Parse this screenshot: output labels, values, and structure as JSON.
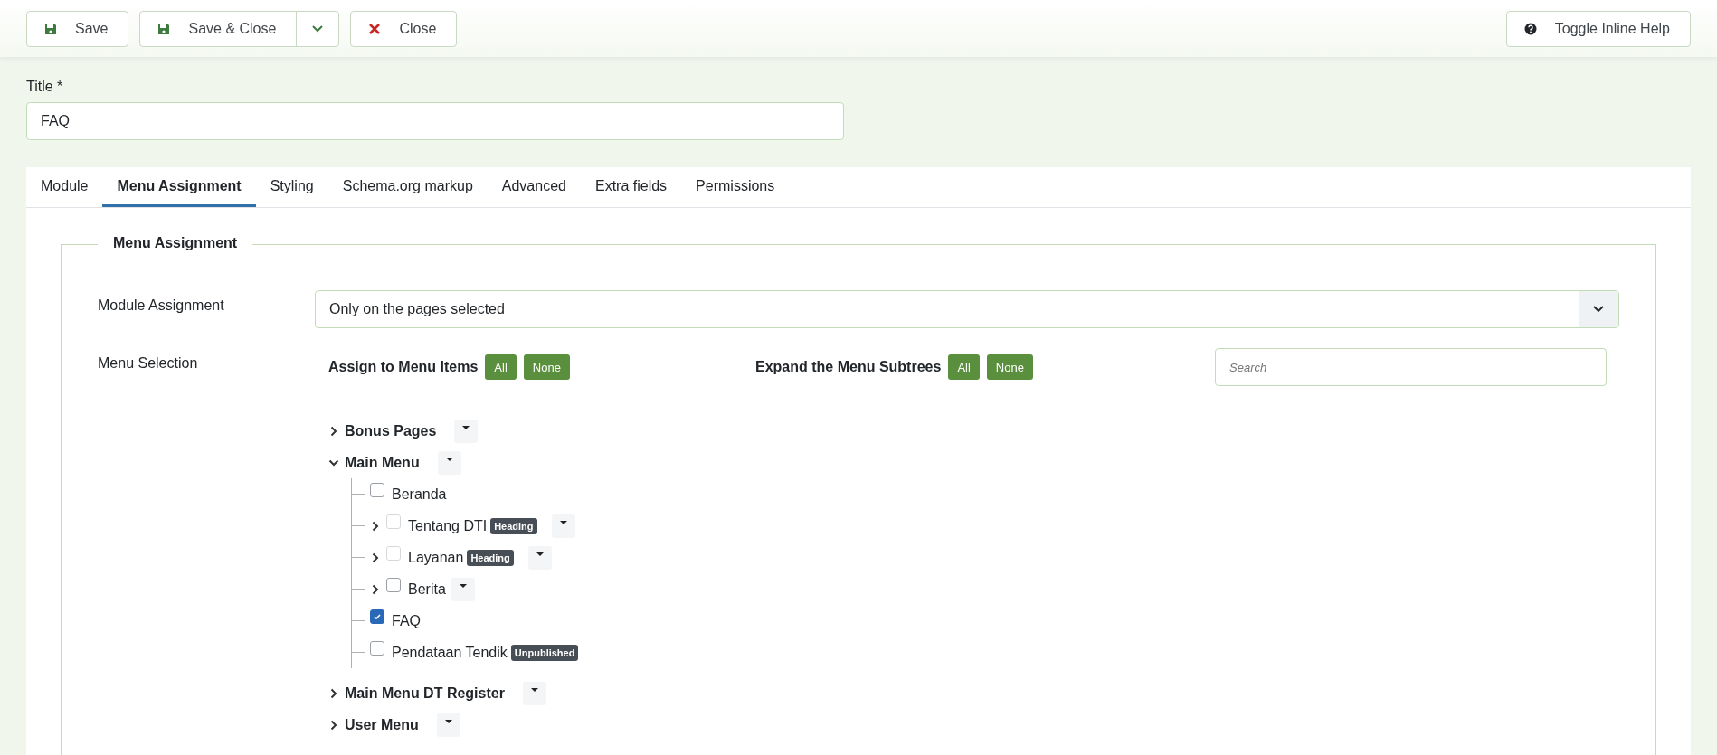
{
  "toolbar": {
    "buttons": [
      {
        "label": "Save",
        "kind": "save"
      },
      {
        "label": "Save & Close",
        "kind": "save-split"
      },
      {
        "label": "Close",
        "kind": "close"
      }
    ],
    "help_button": {
      "label": "Toggle Inline Help"
    }
  },
  "title_field": {
    "label": "Title *",
    "value": "FAQ"
  },
  "tabs": [
    {
      "label": "Module",
      "selected": false
    },
    {
      "label": "Menu Assignment",
      "selected": true
    },
    {
      "label": "Styling",
      "selected": false
    },
    {
      "label": "Schema.org markup",
      "selected": false
    },
    {
      "label": "Advanced",
      "selected": false
    },
    {
      "label": "Extra fields",
      "selected": false
    },
    {
      "label": "Permissions",
      "selected": false
    }
  ],
  "fieldset": {
    "legend": "Menu Assignment",
    "module_assignment": {
      "label": "Module Assignment",
      "value": "Only on the pages selected"
    },
    "menu_selection": {
      "label": "Menu Selection",
      "assign": {
        "label": "Assign to Menu Items",
        "buttons": [
          "All",
          "None"
        ]
      },
      "expand": {
        "label": "Expand the Menu Subtrees",
        "buttons": [
          "All",
          "None"
        ]
      },
      "search": {
        "placeholder": "Search"
      },
      "tree": [
        {
          "label": "Bonus Pages",
          "kind": "menu",
          "expanded": false
        },
        {
          "label": "Main Menu",
          "kind": "menu",
          "expanded": true,
          "children": [
            {
              "label": "Beranda",
              "checked": false,
              "disabled": false
            },
            {
              "label": "Tentang DTI",
              "checked": false,
              "disabled": true,
              "expanded": false,
              "badge": "Heading"
            },
            {
              "label": "Layanan",
              "checked": false,
              "disabled": true,
              "expanded": false,
              "badge": "Heading"
            },
            {
              "label": "Berita",
              "checked": false,
              "disabled": false,
              "expanded": false
            },
            {
              "label": "FAQ",
              "checked": true,
              "disabled": false
            },
            {
              "label": "Pendataan Tendik",
              "checked": false,
              "disabled": false,
              "badge": "Unpublished"
            }
          ]
        },
        {
          "label": "Main Menu DT Register",
          "kind": "menu",
          "expanded": false
        },
        {
          "label": "User Menu",
          "kind": "menu",
          "expanded": false
        }
      ]
    }
  }
}
